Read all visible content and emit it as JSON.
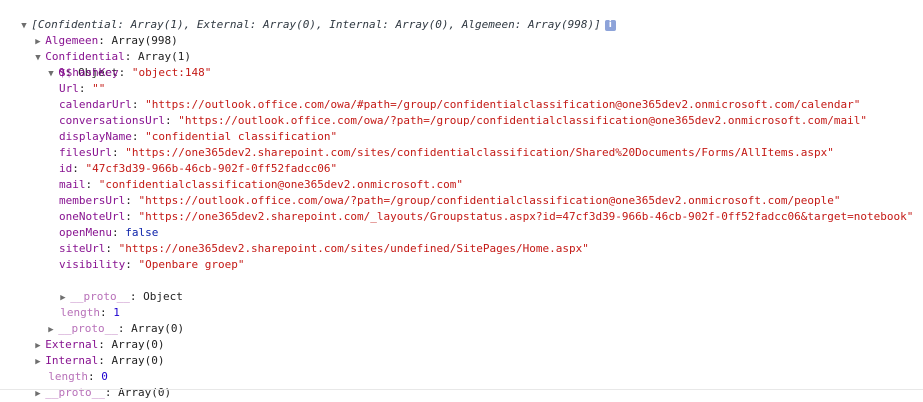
{
  "summary": {
    "arrow": "▼",
    "text": "[Confidential: Array(1), External: Array(0), Internal: Array(0), Algemeen: Array(998)]",
    "info_icon": "info-icon"
  },
  "algemeen": {
    "arrow": "▶",
    "key": "Algemeen",
    "value": "Array(998)"
  },
  "confidential": {
    "arrow": "▼",
    "key": "Confidential",
    "value": "Array(1)"
  },
  "item0": {
    "arrow": "▼",
    "key": "0",
    "value": "Object",
    "props": [
      {
        "key": "$$hashKey",
        "value": "\"object:148\""
      },
      {
        "key": "Url",
        "value": "\"\""
      },
      {
        "key": "calendarUrl",
        "value": "\"https://outlook.office.com/owa/#path=/group/confidentialclassification@one365dev2.onmicrosoft.com/calendar\""
      },
      {
        "key": "conversationsUrl",
        "value": "\"https://outlook.office.com/owa/?path=/group/confidentialclassification@one365dev2.onmicrosoft.com/mail\""
      },
      {
        "key": "displayName",
        "value": "\"confidential classification\""
      },
      {
        "key": "filesUrl",
        "value": "\"https://one365dev2.sharepoint.com/sites/confidentialclassification/Shared%20Documents/Forms/AllItems.aspx\""
      },
      {
        "key": "id",
        "value": "\"47cf3d39-966b-46cb-902f-0ff52fadcc06\""
      },
      {
        "key": "mail",
        "value": "\"confidentialclassification@one365dev2.onmicrosoft.com\""
      },
      {
        "key": "membersUrl",
        "value": "\"https://outlook.office.com/owa/?path=/group/confidentialclassification@one365dev2.onmicrosoft.com/people\""
      },
      {
        "key": "oneNoteUrl",
        "value": "\"https://one365dev2.sharepoint.com/_layouts/Groupstatus.aspx?id=47cf3d39-966b-46cb-902f-0ff52fadcc06&target=notebook\""
      },
      {
        "key": "openMenu",
        "value": "false"
      },
      {
        "key": "siteUrl",
        "value": "\"https://one365dev2.sharepoint.com/sites/undefined/SitePages/Home.aspx\""
      },
      {
        "key": "visibility",
        "value": "\"Openbare groep\""
      }
    ],
    "proto": {
      "arrow": "▶",
      "key": "__proto__",
      "value": "Object"
    }
  },
  "conf_length": {
    "key": "length",
    "value": "1"
  },
  "conf_proto": {
    "arrow": "▶",
    "key": "__proto__",
    "value": "Array(0)"
  },
  "external": {
    "arrow": "▶",
    "key": "External",
    "value": "Array(0)"
  },
  "internal": {
    "arrow": "▶",
    "key": "Internal",
    "value": "Array(0)"
  },
  "root_length": {
    "key": "length",
    "value": "0"
  },
  "root_proto": {
    "arrow": "▶",
    "key": "__proto__",
    "value": "Array(0)"
  }
}
